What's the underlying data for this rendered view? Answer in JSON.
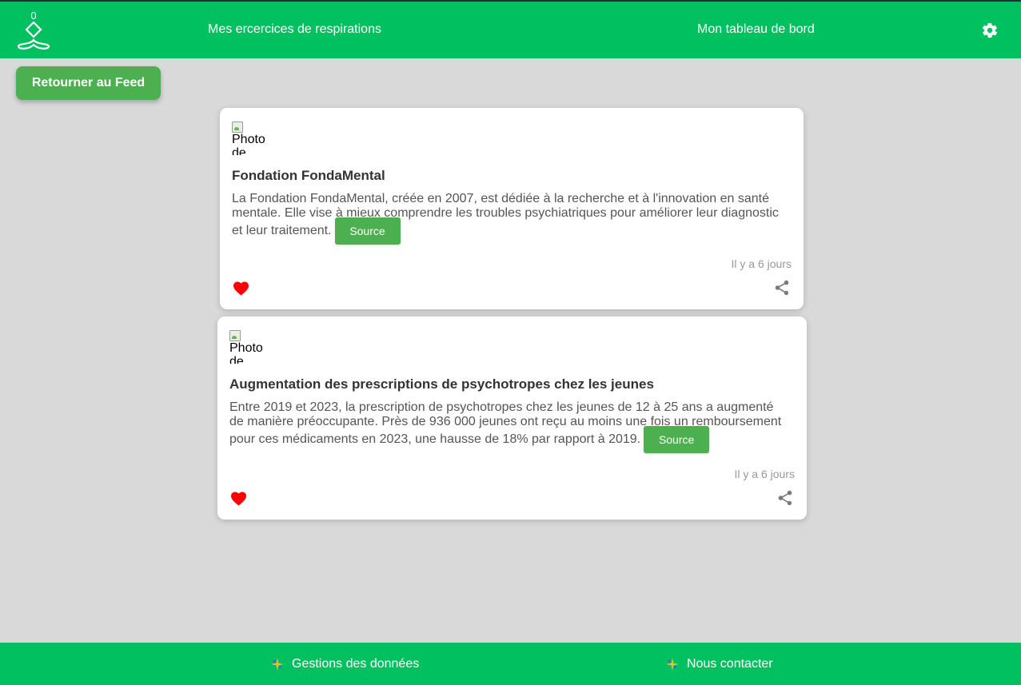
{
  "nav": {
    "breathing_label": "Mes ercercices de respirations",
    "dashboard_label": "Mon tableau de bord",
    "logo_char": "0"
  },
  "back_button_label": "Retourner au Feed",
  "cards": [
    {
      "photo_alt": "Photo de",
      "photo_alt_line1": "Photo",
      "title": "Fondation FondaMental",
      "text_line1": "La Fondation FondaMental, créée en 2007, est dédiée à la recherche et à l'innovation en santé",
      "text_line2": "mentale. Elle vise à mieux comprendre les troubles psychiatriques pour améliorer leur diagnostic",
      "text_line3": "et leur traitement.",
      "source_label": "Source",
      "timestamp": "Il y a 6 jours"
    },
    {
      "photo_alt": "Photo de",
      "photo_alt_line1": "Photo",
      "title": "Augmentation des prescriptions de psychotropes chez les jeunes",
      "text_line1": "Entre 2019 et 2023, la prescription de psychotropes chez les jeunes de 12 à 25 ans a augmenté",
      "text_line2": "de manière préoccupante. Près de 936 000 jeunes ont reçu au moins une fois un remboursement",
      "text_line3": "pour ces médicaments en 2023, une hausse de 18% par rapport à 2019.",
      "source_label": "Source",
      "timestamp": "Il y a 6 jours"
    }
  ],
  "footer": {
    "data_label": "Gestions des données",
    "contact_label": "Nous contacter"
  },
  "colors": {
    "primary_green": "#00c060",
    "button_green": "#4caf50",
    "heart_red": "#ff0000",
    "background": "#d9d9d9"
  },
  "icons": [
    "meditation-logo-icon",
    "gear-icon",
    "photo-placeholder-icon",
    "heart-icon",
    "share-icon",
    "sparkle-icon"
  ]
}
